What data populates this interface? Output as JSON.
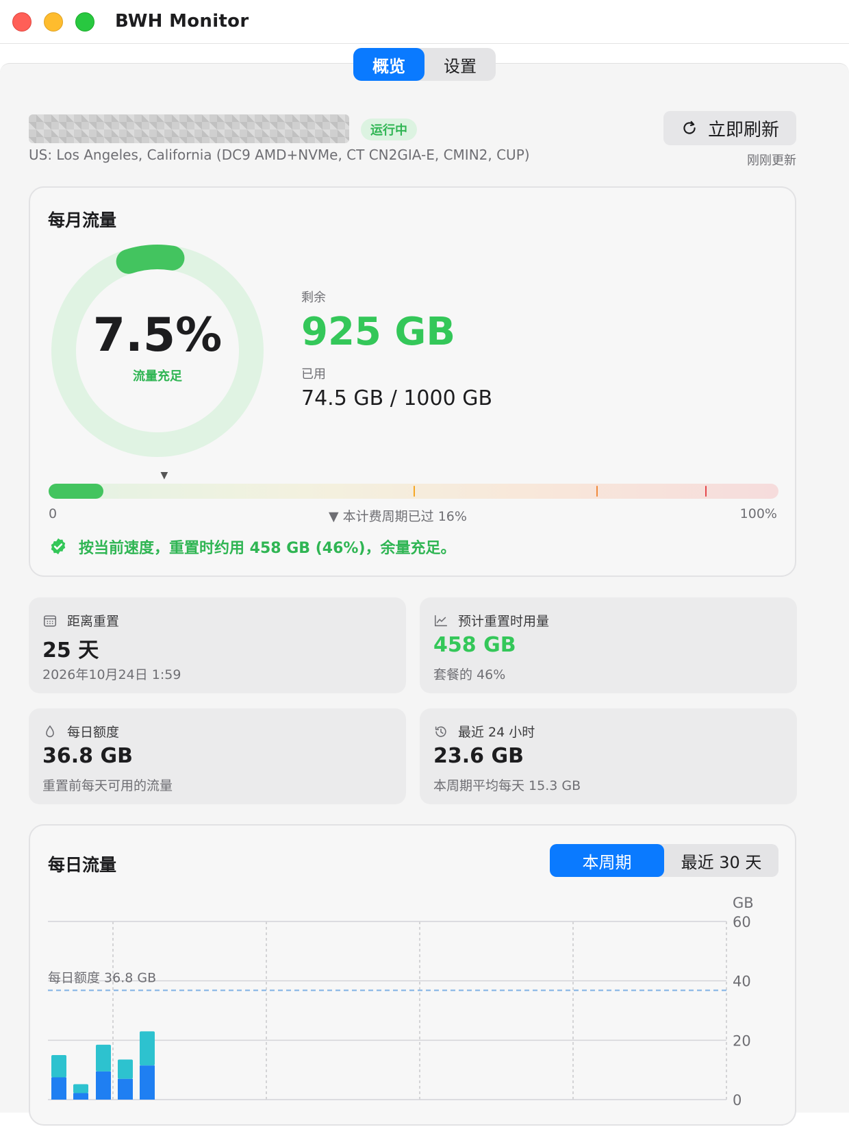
{
  "window": {
    "title": "BWH Monitor"
  },
  "tabs": [
    {
      "label": "概览",
      "active": true
    },
    {
      "label": "设置",
      "active": false
    }
  ],
  "server": {
    "status": "运行中",
    "location": "US: Los Angeles, California (DC9 AMD+NVMe, CT CN2GIA-E, CMIN2, CUP)",
    "refresh_label": "立即刷新",
    "updated_text": "刚刚更新"
  },
  "monthly": {
    "title": "每月流量",
    "percent_text": "7.5%",
    "percent_used": 0.075,
    "ring_status": "流量充足",
    "remaining_label": "剩余",
    "remaining_value": "925 GB",
    "used_label": "已用",
    "used_value": "74.5 GB / 1000 GB",
    "bar_min_label": "0",
    "bar_max_label": "100%",
    "period_label": "▼ 本计费周期已过 16%",
    "period_elapsed": 0.16,
    "period_marker_glyph": "▼",
    "thresholds": [
      {
        "at": 0.5,
        "color": "#f5a623"
      },
      {
        "at": 0.75,
        "color": "#f08a3c"
      },
      {
        "at": 0.9,
        "color": "#e5484d"
      }
    ],
    "forecast_text": "按当前速度，重置时约用 458 GB (46%)，余量充足。"
  },
  "tiles": [
    {
      "icon": "calendar-icon",
      "label": "距离重置",
      "value": "25 天",
      "sub": "2026年10月24日 1:59",
      "value_color": "normal"
    },
    {
      "icon": "trend-chart-icon",
      "label": "预计重置时用量",
      "value": "458 GB",
      "sub": "套餐的 46%",
      "value_color": "green"
    },
    {
      "icon": "drop-icon",
      "label": "每日额度",
      "value": "36.8 GB",
      "sub": "重置前每天可用的流量",
      "value_color": "normal"
    },
    {
      "icon": "history-icon",
      "label": "最近 24 小时",
      "value": "23.6 GB",
      "sub": "本周期平均每天 15.3 GB",
      "value_color": "normal"
    }
  ],
  "daily": {
    "title": "每日流量",
    "ranges": [
      {
        "label": "本周期",
        "active": true
      },
      {
        "label": "最近 30 天",
        "active": false
      }
    ],
    "colors": {
      "download": "#1f7ff2",
      "upload": "#2dc2cf",
      "quota_line": "#7fb2e5"
    },
    "chart_data": {
      "type": "bar",
      "stacked": true,
      "ylabel": "GB",
      "ylim": [
        0,
        60
      ],
      "yticks": [
        "60",
        "40",
        "20",
        "0"
      ],
      "quota_line": {
        "label": "每日额度 36.8 GB",
        "value": 36.8
      },
      "series": [
        {
          "values": [
            7.5,
            2.2,
            9.5,
            7.0,
            11.5
          ]
        },
        {
          "values": [
            7.5,
            3.0,
            9.0,
            6.5,
            11.5
          ]
        }
      ]
    }
  }
}
